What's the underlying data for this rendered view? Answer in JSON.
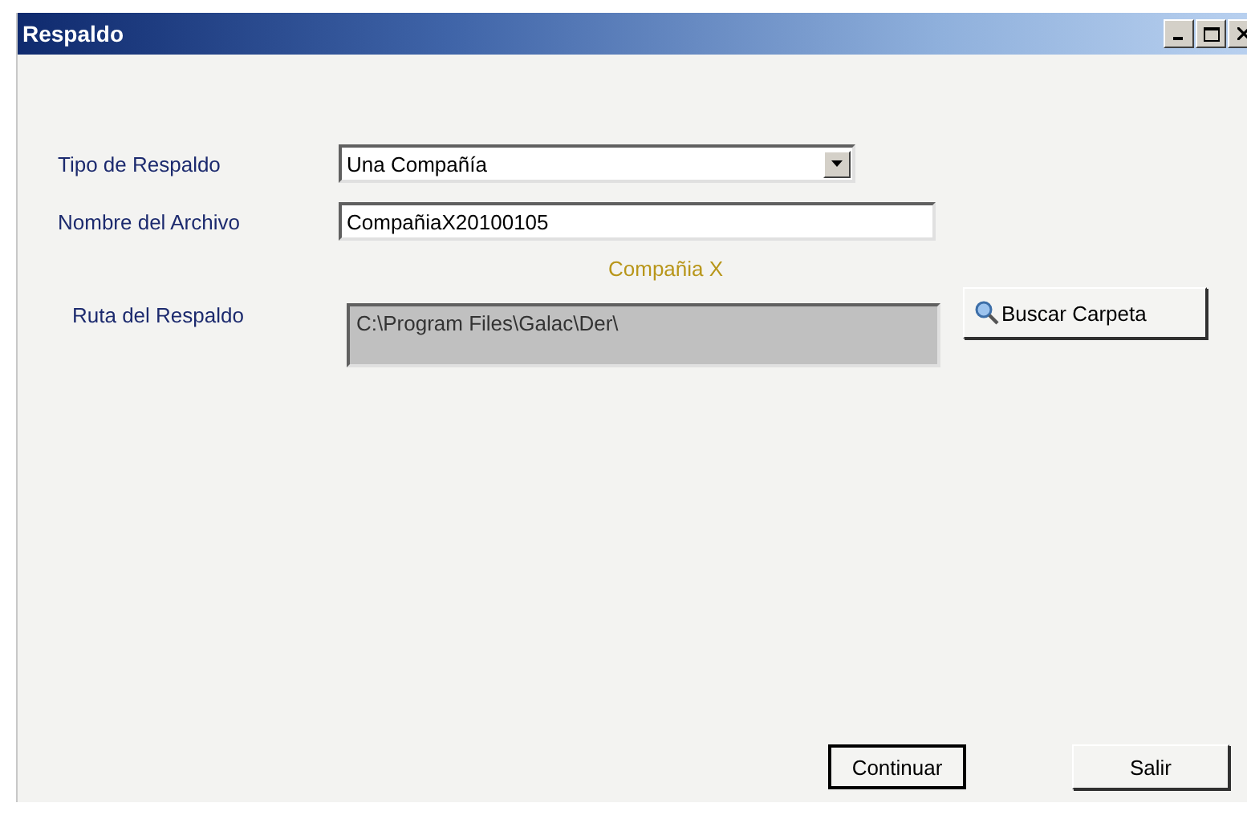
{
  "window": {
    "title": "Respaldo"
  },
  "form": {
    "backup_type": {
      "label": "Tipo de Respaldo",
      "value": "Una Compañía"
    },
    "file_name": {
      "label": "Nombre del Archivo",
      "value": "CompañiaX20100105"
    },
    "company_caption": "Compañia X",
    "backup_path": {
      "label": "Ruta del Respaldo",
      "value": "C:\\Program Files\\Galac\\Der\\",
      "disabled": true
    },
    "browse_button": "Buscar Carpeta"
  },
  "buttons": [
    {
      "label": "Continuar",
      "default": true
    },
    {
      "label": "Salir",
      "default": false
    }
  ]
}
